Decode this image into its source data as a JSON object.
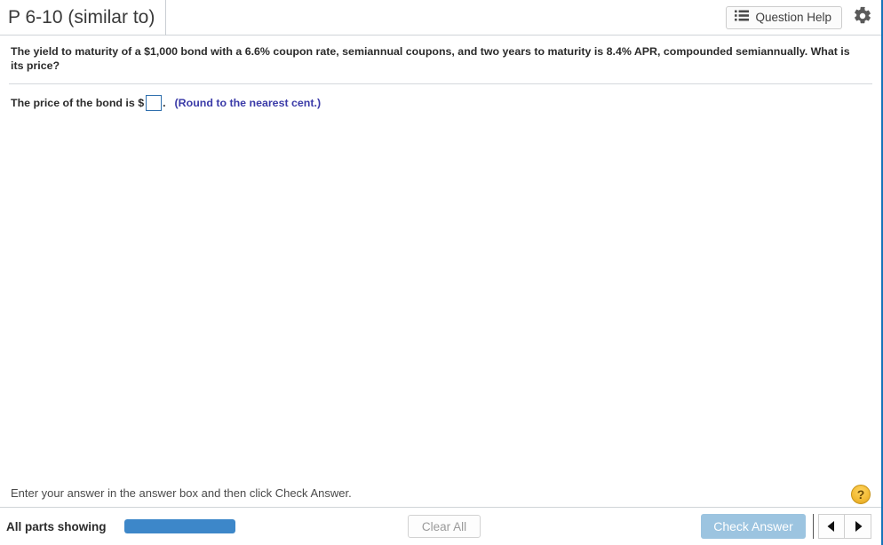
{
  "header": {
    "title": "P 6-10 (similar to)",
    "question_help_label": "Question Help",
    "question_help_icon": "list-icon",
    "settings_icon": "gear-icon"
  },
  "question": {
    "text": "The yield to maturity of a $1,000 bond with a 6.6% coupon rate, semiannual coupons, and two years to maturity is 8.4% APR, compounded semiannually. What is its price?"
  },
  "answer": {
    "prompt": "The price of the bond is $",
    "value": "",
    "placeholder": "",
    "period": ".",
    "rounding_hint": "(Round to the nearest cent.)",
    "input_border_color": "#2f6fad",
    "hint_color": "#3b3ba8"
  },
  "footer": {
    "instruction": "Enter your answer in the answer box and then click Check Answer.",
    "help_button_label": "?",
    "parts_status": "All parts showing",
    "progress_percent": 100,
    "progress_color": "#3d87c9",
    "clear_all_label": "Clear All",
    "check_answer_label": "Check Answer",
    "check_answer_color": "#9cc4e0",
    "prev_icon": "left-triangle-icon",
    "next_icon": "right-triangle-icon"
  },
  "chrome": {
    "right_border_color": "#1673b9"
  }
}
